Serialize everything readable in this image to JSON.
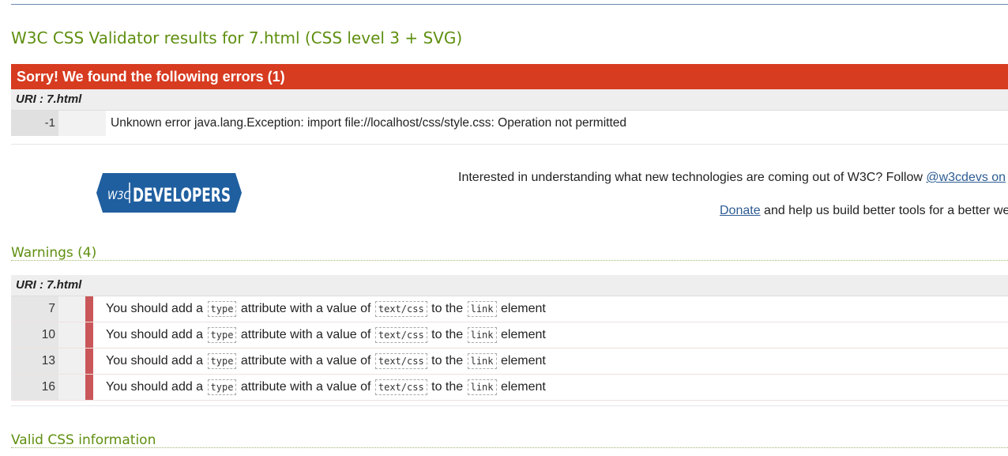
{
  "page": {
    "title": "W3C CSS Validator results for 7.html (CSS level 3 + SVG)"
  },
  "errors": {
    "header": "Sorry! We found the following errors (1)",
    "uri": "URI : 7.html",
    "rows": [
      {
        "line": "-1",
        "message": "Unknown error java.lang.Exception: import file://localhost/css/style.css: Operation not permitted"
      }
    ]
  },
  "promo": {
    "logo_text": "DEVELOPERS",
    "logo_badge": "W3C",
    "line1_text": "Interested in understanding what new technologies are coming out of W3C? Follow ",
    "line1_link": "@w3cdevs on",
    "donate_link": "Donate",
    "line2_text": " and help us build better tools for a better we"
  },
  "warnings": {
    "title": "Warnings (4)",
    "uri": "URI : 7.html",
    "rows": [
      {
        "line": "7",
        "pre": "You should add a ",
        "code1": "type",
        "mid1": " attribute with a value of ",
        "code2": "text/css",
        "mid2": " to the ",
        "code3": "link",
        "post": " element"
      },
      {
        "line": "10",
        "pre": "You should add a ",
        "code1": "type",
        "mid1": " attribute with a value of ",
        "code2": "text/css",
        "mid2": " to the ",
        "code3": "link",
        "post": " element"
      },
      {
        "line": "13",
        "pre": "You should add a ",
        "code1": "type",
        "mid1": " attribute with a value of ",
        "code2": "text/css",
        "mid2": " to the ",
        "code3": "link",
        "post": " element"
      },
      {
        "line": "16",
        "pre": "You should add a ",
        "code1": "type",
        "mid1": " attribute with a value of ",
        "code2": "text/css",
        "mid2": " to the ",
        "code3": "link",
        "post": " element"
      }
    ]
  },
  "valid_info": {
    "title": "Valid CSS information"
  },
  "colors": {
    "accent_green": "#5f8f10",
    "error_red": "#d73b20",
    "warning_bar": "#c9575a",
    "logo_blue": "#1f5fa0"
  }
}
